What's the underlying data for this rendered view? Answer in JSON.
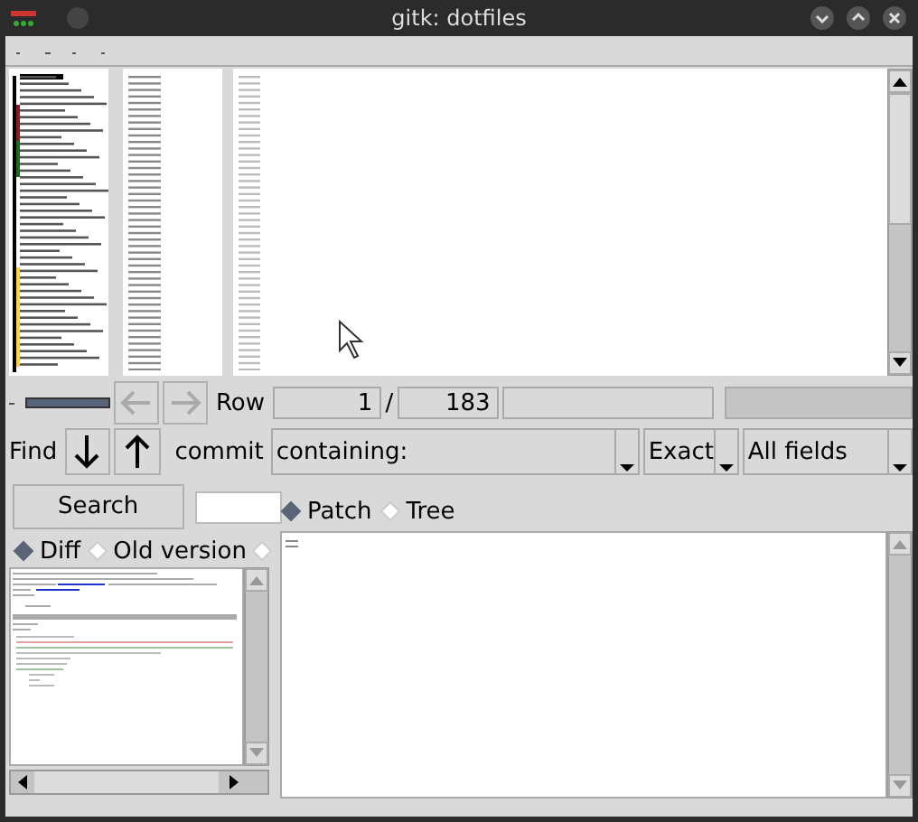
{
  "window": {
    "title": "gitk: dotfiles"
  },
  "zoom": {
    "level": 1
  },
  "nav": {
    "row_label": "Row",
    "row": "1",
    "row_sep": "/",
    "total": "183"
  },
  "find": {
    "label": "Find",
    "type_label": "commit",
    "mode": "containing:",
    "match": "Exact",
    "fields": "All fields"
  },
  "search": {
    "button": "Search"
  },
  "view_options": [
    {
      "label": "Patch",
      "selected": true
    },
    {
      "label": "Tree",
      "selected": false
    }
  ],
  "diff_options": [
    {
      "label": "Diff",
      "selected": true
    },
    {
      "label": "Old version",
      "selected": false
    },
    {
      "selected": false
    }
  ]
}
